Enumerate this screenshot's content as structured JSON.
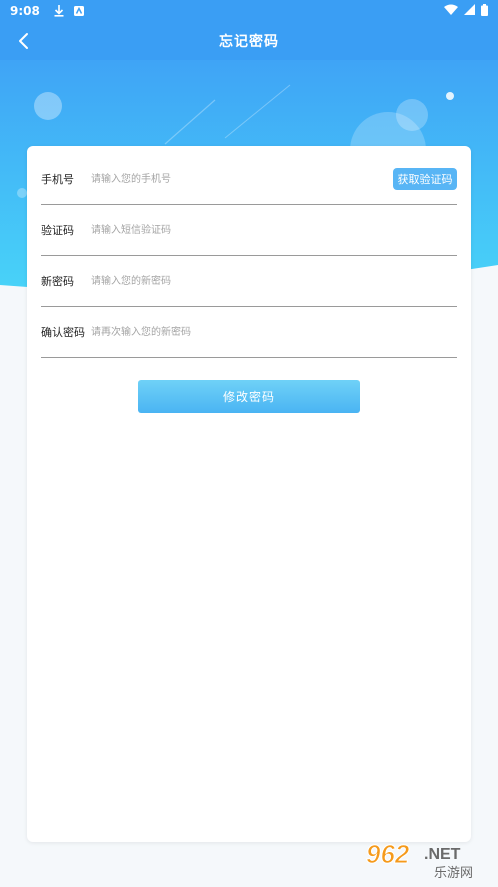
{
  "status_bar": {
    "time": "9:08"
  },
  "header": {
    "title": "忘记密码"
  },
  "form": {
    "phone": {
      "label": "手机号",
      "placeholder": "请输入您的手机号"
    },
    "get_code_label": "获取验证码",
    "code": {
      "label": "验证码",
      "placeholder": "请输入短信验证码"
    },
    "new_password": {
      "label": "新密码",
      "placeholder": "请输入您的新密码"
    },
    "confirm_password": {
      "label": "确认密码",
      "placeholder": "请再次输入您的新密码"
    },
    "submit_label": "修改密码"
  },
  "watermark": {
    "text_top": "962.NET",
    "text_bottom": "乐游网"
  },
  "colors": {
    "primary": "#3a9ef4",
    "button": "#58b5f5",
    "hero_top": "#3fa4f6",
    "hero_bottom": "#48d3f8"
  },
  "icons": {
    "back": "chevron-left-icon",
    "download": "download-icon",
    "app": "app-icon",
    "wifi": "wifi-icon",
    "signal": "signal-icon",
    "battery": "battery-icon"
  }
}
